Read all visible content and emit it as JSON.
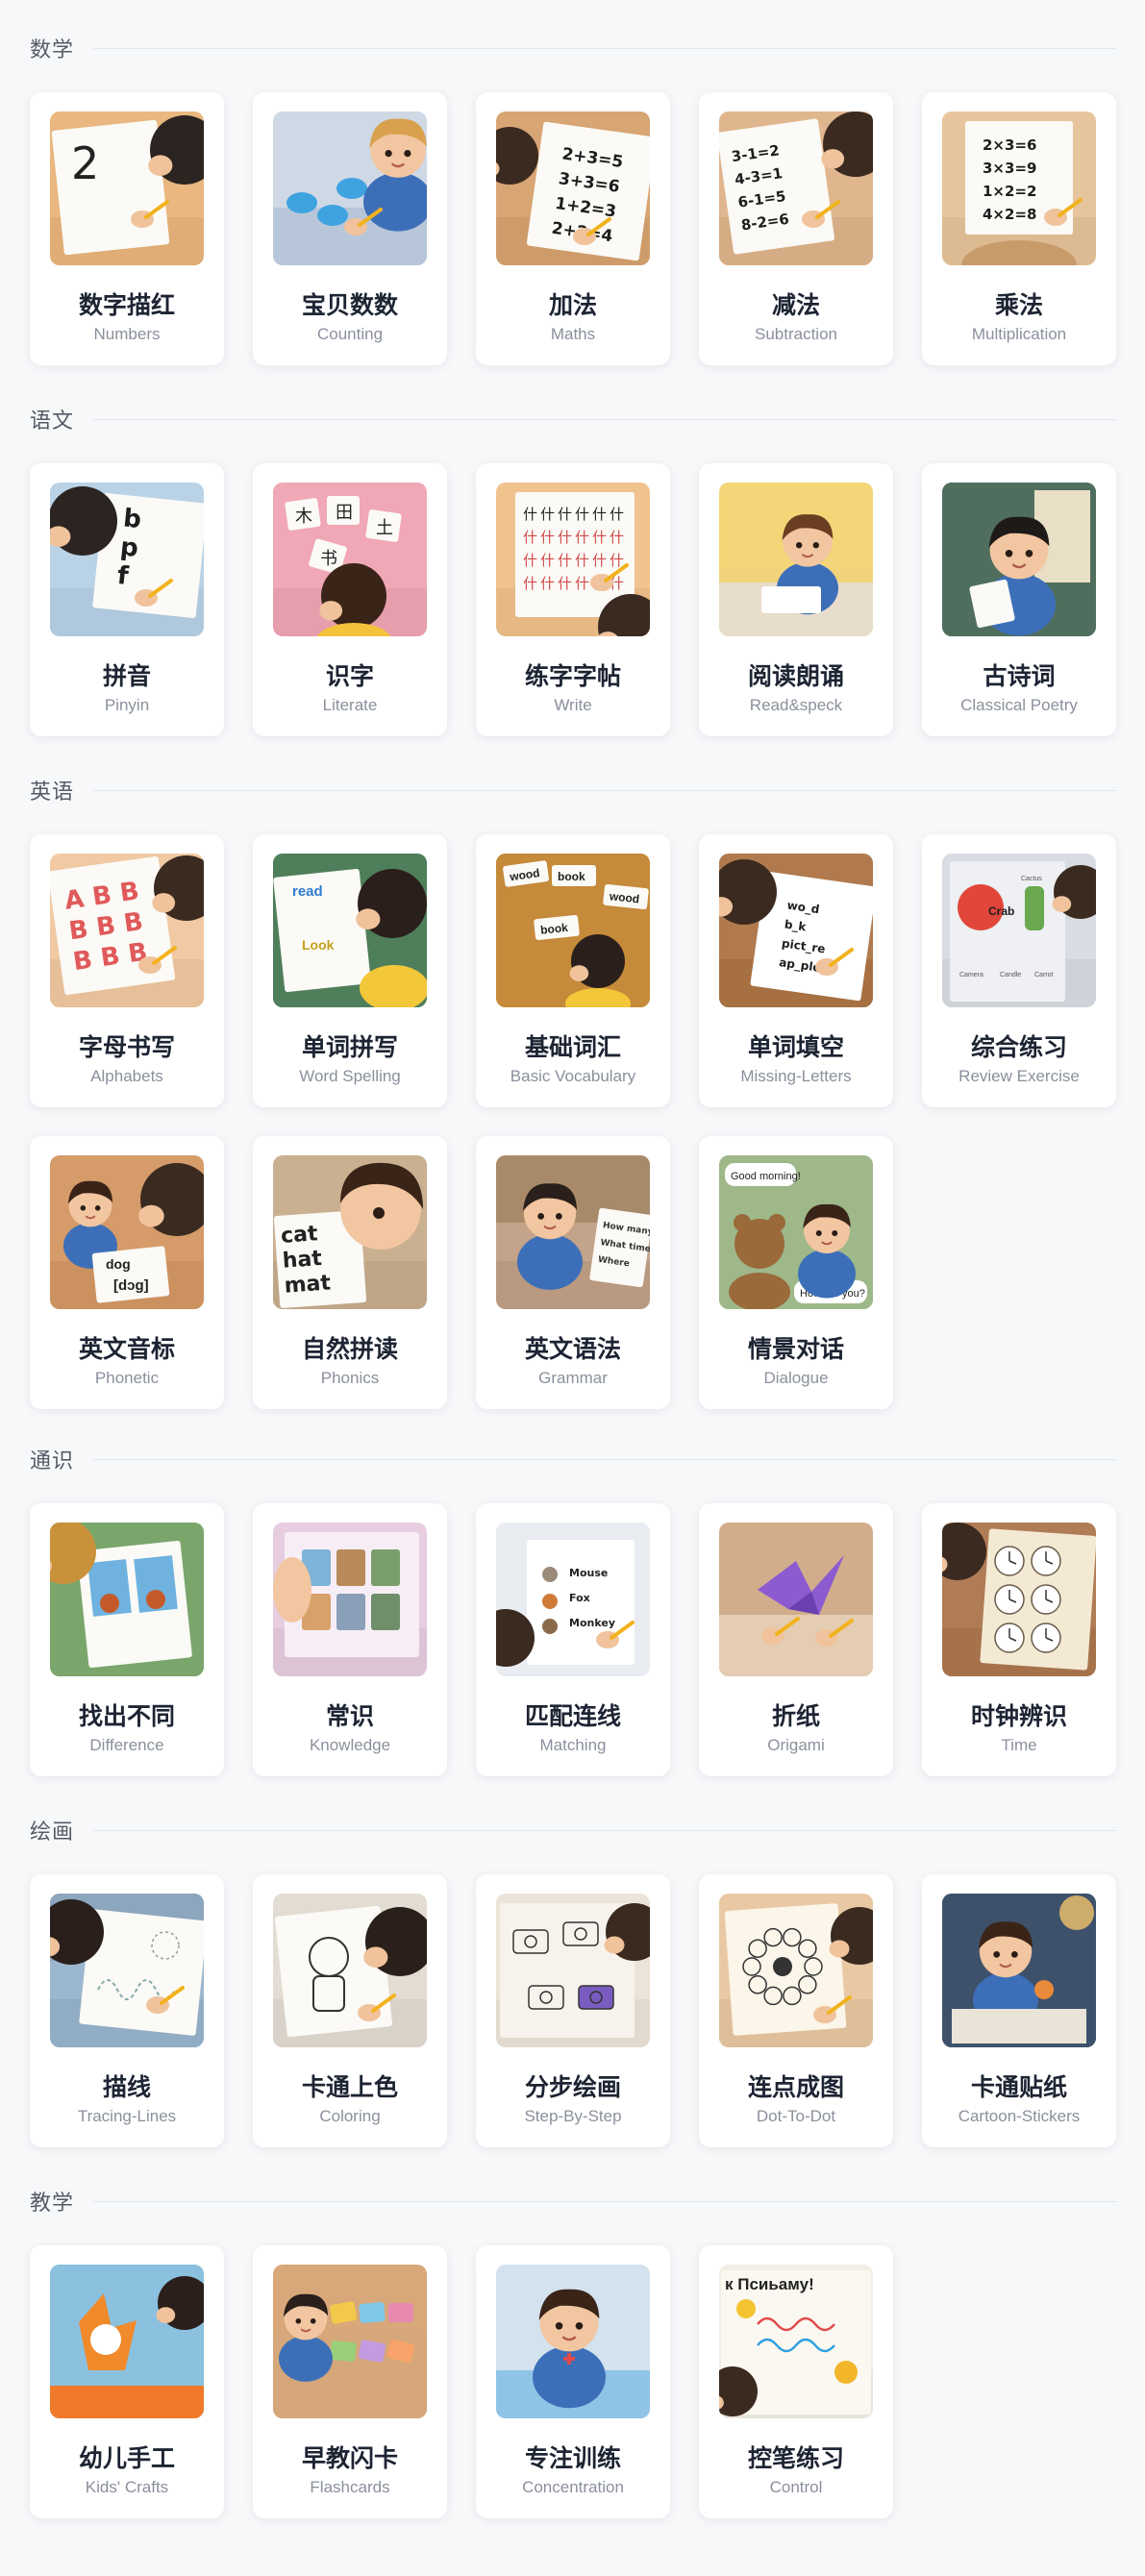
{
  "sections": [
    {
      "title": "数学",
      "items": [
        {
          "title": "数字描红",
          "subtitle": "Numbers",
          "icon": "numbers-image",
          "color": "#e9b77f"
        },
        {
          "title": "宝贝数数",
          "subtitle": "Counting",
          "icon": "counting-image",
          "color": "#cfd9e6"
        },
        {
          "title": "加法",
          "subtitle": "Maths",
          "icon": "maths-image",
          "color": "#d8a574"
        },
        {
          "title": "减法",
          "subtitle": "Subtraction",
          "icon": "subtraction-image",
          "color": "#e0b68f"
        },
        {
          "title": "乘法",
          "subtitle": "Multiplication",
          "icon": "multiplication-image",
          "color": "#e7c59c"
        }
      ]
    },
    {
      "title": "语文",
      "items": [
        {
          "title": "拼音",
          "subtitle": "Pinyin",
          "icon": "pinyin-image",
          "color": "#b9d2e6"
        },
        {
          "title": "识字",
          "subtitle": "Literate",
          "icon": "literate-image",
          "color": "#f0a7b6"
        },
        {
          "title": "练字字帖",
          "subtitle": "Write",
          "icon": "write-image",
          "color": "#f0c38e"
        },
        {
          "title": "阅读朗诵",
          "subtitle": "Read&speck",
          "icon": "read-speck-image",
          "color": "#f2d27a"
        },
        {
          "title": "古诗词",
          "subtitle": "Classical Poetry",
          "icon": "classical-poetry-image",
          "color": "#6f8b74"
        }
      ]
    },
    {
      "title": "英语",
      "items": [
        {
          "title": "字母书写",
          "subtitle": "Alphabets",
          "icon": "alphabets-image",
          "color": "#f1c9a3"
        },
        {
          "title": "单词拼写",
          "subtitle": "Word Spelling",
          "icon": "word-spelling-image",
          "color": "#5f8a63"
        },
        {
          "title": "基础词汇",
          "subtitle": "Basic Vocabulary",
          "icon": "basic-vocabulary-image",
          "color": "#c98a3d"
        },
        {
          "title": "单词填空",
          "subtitle": "Missing-Letters",
          "icon": "missing-letters-image",
          "color": "#b07a4e"
        },
        {
          "title": "综合练习",
          "subtitle": "Review Exercise",
          "icon": "review-exercise-image",
          "color": "#d9dde3"
        },
        {
          "title": "英文音标",
          "subtitle": "Phonetic",
          "icon": "phonetic-image",
          "color": "#d59b69"
        },
        {
          "title": "自然拼读",
          "subtitle": "Phonics",
          "icon": "phonics-image",
          "color": "#c9b091"
        },
        {
          "title": "英文语法",
          "subtitle": "Grammar",
          "icon": "grammar-image",
          "color": "#c3a38a"
        },
        {
          "title": "情景对话",
          "subtitle": "Dialogue",
          "icon": "dialogue-image",
          "color": "#a6b88a"
        }
      ]
    },
    {
      "title": "通识",
      "items": [
        {
          "title": "找出不同",
          "subtitle": "Difference",
          "icon": "difference-image",
          "color": "#86b07a"
        },
        {
          "title": "常识",
          "subtitle": "Knowledge",
          "icon": "knowledge-image",
          "color": "#e6cde0"
        },
        {
          "title": "匹配连线",
          "subtitle": "Matching",
          "icon": "matching-image",
          "color": "#eceef1"
        },
        {
          "title": "折纸",
          "subtitle": "Origami",
          "icon": "origami-image",
          "color": "#d2ad8b"
        },
        {
          "title": "时钟辨识",
          "subtitle": "Time",
          "icon": "time-image",
          "color": "#b07c56"
        }
      ]
    },
    {
      "title": "绘画",
      "items": [
        {
          "title": "描线",
          "subtitle": "Tracing-Lines",
          "icon": "tracing-lines-image",
          "color": "#9bb7cf"
        },
        {
          "title": "卡通上色",
          "subtitle": "Coloring",
          "icon": "coloring-image",
          "color": "#e3dcd2"
        },
        {
          "title": "分步绘画",
          "subtitle": "Step-By-Step",
          "icon": "step-by-step-image",
          "color": "#ece4d8"
        },
        {
          "title": "连点成图",
          "subtitle": "Dot-To-Dot",
          "icon": "dot-to-dot-image",
          "color": "#e9c9a4"
        },
        {
          "title": "卡通贴纸",
          "subtitle": "Cartoon-Stickers",
          "icon": "cartoon-stickers-image",
          "color": "#4a5e78"
        }
      ]
    },
    {
      "title": "教学",
      "items": [
        {
          "title": "幼儿手工",
          "subtitle": "Kids' Crafts",
          "icon": "kids-crafts-image",
          "color": "#8cb9d9"
        },
        {
          "title": "早教闪卡",
          "subtitle": "Flashcards",
          "icon": "flashcards-image",
          "color": "#d8a77a"
        },
        {
          "title": "专注训练",
          "subtitle": "Concentration",
          "icon": "concentration-image",
          "color": "#cfe0ee"
        },
        {
          "title": "控笔练习",
          "subtitle": "Control",
          "icon": "control-image",
          "color": "#f3eee4"
        }
      ]
    }
  ],
  "thumb_text": {
    "numbers": "2",
    "maths": [
      "2+3=5",
      "3+3=6",
      "1+2=3",
      "2+2=4"
    ],
    "subtraction": [
      "3-1=2",
      "4-3=1",
      "6-1=5",
      "8-2=6"
    ],
    "multiplication": [
      "2×3=6",
      "3×3=9",
      "1×2=2",
      "4×2=8"
    ],
    "pinyin": [
      "b",
      "p",
      "f"
    ],
    "literate": [
      "木",
      "田",
      "土",
      "书"
    ],
    "write": "什",
    "alphabets": [
      "A B B",
      "B B B",
      "B B B"
    ],
    "word_spelling": [
      "read",
      "Look"
    ],
    "basic_vocabulary": [
      "wood",
      "book",
      "wood",
      "book"
    ],
    "missing_letters": [
      "wo_d",
      "b_k",
      "pict_re",
      "ap_ple"
    ],
    "review_exercise": [
      "Crab",
      "Cactus",
      "Camera",
      "Candle",
      "Carrot"
    ],
    "phonetic": [
      "dog",
      "[dɔg]"
    ],
    "phonics": [
      "cat",
      "hat",
      "mat"
    ],
    "grammar": [
      "How many",
      "What time",
      "Where"
    ],
    "dialogue": [
      "Good morning!",
      "How are you?"
    ],
    "matching": [
      "Mouse",
      "Fox",
      "Monkey"
    ],
    "control": "к Пcиьаму!"
  }
}
